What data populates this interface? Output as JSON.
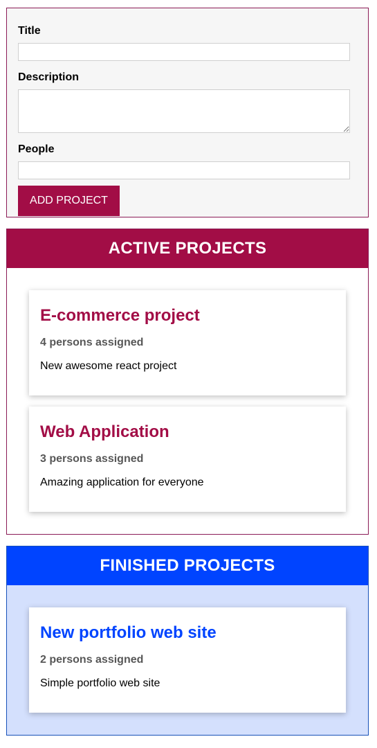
{
  "form": {
    "title_label": "Title",
    "title_value": "",
    "description_label": "Description",
    "description_value": "",
    "people_label": "People",
    "people_value": "",
    "submit_label": "ADD PROJECT"
  },
  "active": {
    "header": "ACTIVE PROJECTS",
    "projects": [
      {
        "title": "E-commerce project",
        "people": "4 persons assigned",
        "description": "New awesome react project"
      },
      {
        "title": "Web Application",
        "people": "3 persons assigned",
        "description": "Amazing application for everyone"
      }
    ]
  },
  "finished": {
    "header": "FINISHED PROJECTS",
    "projects": [
      {
        "title": "New portfolio web site",
        "people": "2 persons assigned",
        "description": "Simple portfolio web site"
      }
    ]
  },
  "colors": {
    "active_accent": "#a20d46",
    "finished_accent": "#0044ff",
    "finished_background": "#d4e0fd"
  }
}
